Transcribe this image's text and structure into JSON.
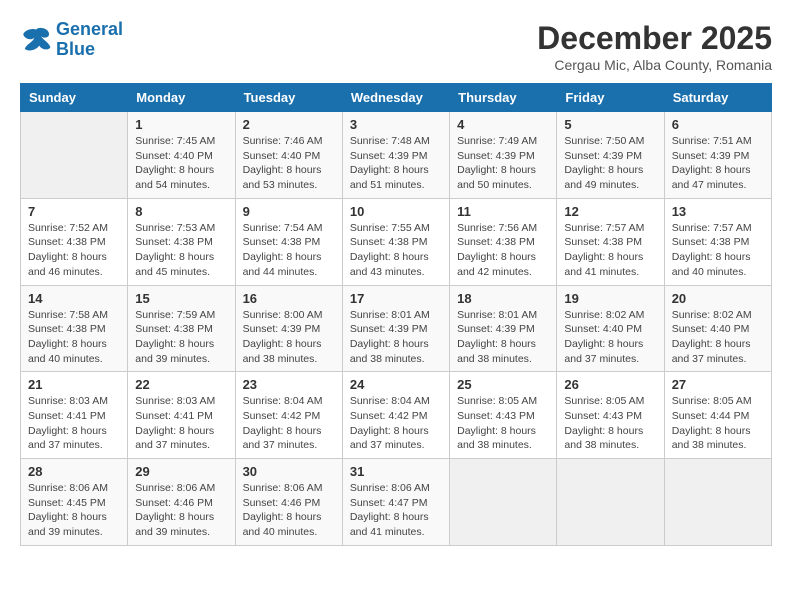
{
  "logo": {
    "line1": "General",
    "line2": "Blue"
  },
  "title": "December 2025",
  "subtitle": "Cergau Mic, Alba County, Romania",
  "days_of_week": [
    "Sunday",
    "Monday",
    "Tuesday",
    "Wednesday",
    "Thursday",
    "Friday",
    "Saturday"
  ],
  "weeks": [
    [
      {
        "day": "",
        "sunrise": "",
        "sunset": "",
        "daylight": ""
      },
      {
        "day": "1",
        "sunrise": "Sunrise: 7:45 AM",
        "sunset": "Sunset: 4:40 PM",
        "daylight": "Daylight: 8 hours and 54 minutes."
      },
      {
        "day": "2",
        "sunrise": "Sunrise: 7:46 AM",
        "sunset": "Sunset: 4:40 PM",
        "daylight": "Daylight: 8 hours and 53 minutes."
      },
      {
        "day": "3",
        "sunrise": "Sunrise: 7:48 AM",
        "sunset": "Sunset: 4:39 PM",
        "daylight": "Daylight: 8 hours and 51 minutes."
      },
      {
        "day": "4",
        "sunrise": "Sunrise: 7:49 AM",
        "sunset": "Sunset: 4:39 PM",
        "daylight": "Daylight: 8 hours and 50 minutes."
      },
      {
        "day": "5",
        "sunrise": "Sunrise: 7:50 AM",
        "sunset": "Sunset: 4:39 PM",
        "daylight": "Daylight: 8 hours and 49 minutes."
      },
      {
        "day": "6",
        "sunrise": "Sunrise: 7:51 AM",
        "sunset": "Sunset: 4:39 PM",
        "daylight": "Daylight: 8 hours and 47 minutes."
      }
    ],
    [
      {
        "day": "7",
        "sunrise": "Sunrise: 7:52 AM",
        "sunset": "Sunset: 4:38 PM",
        "daylight": "Daylight: 8 hours and 46 minutes."
      },
      {
        "day": "8",
        "sunrise": "Sunrise: 7:53 AM",
        "sunset": "Sunset: 4:38 PM",
        "daylight": "Daylight: 8 hours and 45 minutes."
      },
      {
        "day": "9",
        "sunrise": "Sunrise: 7:54 AM",
        "sunset": "Sunset: 4:38 PM",
        "daylight": "Daylight: 8 hours and 44 minutes."
      },
      {
        "day": "10",
        "sunrise": "Sunrise: 7:55 AM",
        "sunset": "Sunset: 4:38 PM",
        "daylight": "Daylight: 8 hours and 43 minutes."
      },
      {
        "day": "11",
        "sunrise": "Sunrise: 7:56 AM",
        "sunset": "Sunset: 4:38 PM",
        "daylight": "Daylight: 8 hours and 42 minutes."
      },
      {
        "day": "12",
        "sunrise": "Sunrise: 7:57 AM",
        "sunset": "Sunset: 4:38 PM",
        "daylight": "Daylight: 8 hours and 41 minutes."
      },
      {
        "day": "13",
        "sunrise": "Sunrise: 7:57 AM",
        "sunset": "Sunset: 4:38 PM",
        "daylight": "Daylight: 8 hours and 40 minutes."
      }
    ],
    [
      {
        "day": "14",
        "sunrise": "Sunrise: 7:58 AM",
        "sunset": "Sunset: 4:38 PM",
        "daylight": "Daylight: 8 hours and 40 minutes."
      },
      {
        "day": "15",
        "sunrise": "Sunrise: 7:59 AM",
        "sunset": "Sunset: 4:38 PM",
        "daylight": "Daylight: 8 hours and 39 minutes."
      },
      {
        "day": "16",
        "sunrise": "Sunrise: 8:00 AM",
        "sunset": "Sunset: 4:39 PM",
        "daylight": "Daylight: 8 hours and 38 minutes."
      },
      {
        "day": "17",
        "sunrise": "Sunrise: 8:01 AM",
        "sunset": "Sunset: 4:39 PM",
        "daylight": "Daylight: 8 hours and 38 minutes."
      },
      {
        "day": "18",
        "sunrise": "Sunrise: 8:01 AM",
        "sunset": "Sunset: 4:39 PM",
        "daylight": "Daylight: 8 hours and 38 minutes."
      },
      {
        "day": "19",
        "sunrise": "Sunrise: 8:02 AM",
        "sunset": "Sunset: 4:40 PM",
        "daylight": "Daylight: 8 hours and 37 minutes."
      },
      {
        "day": "20",
        "sunrise": "Sunrise: 8:02 AM",
        "sunset": "Sunset: 4:40 PM",
        "daylight": "Daylight: 8 hours and 37 minutes."
      }
    ],
    [
      {
        "day": "21",
        "sunrise": "Sunrise: 8:03 AM",
        "sunset": "Sunset: 4:41 PM",
        "daylight": "Daylight: 8 hours and 37 minutes."
      },
      {
        "day": "22",
        "sunrise": "Sunrise: 8:03 AM",
        "sunset": "Sunset: 4:41 PM",
        "daylight": "Daylight: 8 hours and 37 minutes."
      },
      {
        "day": "23",
        "sunrise": "Sunrise: 8:04 AM",
        "sunset": "Sunset: 4:42 PM",
        "daylight": "Daylight: 8 hours and 37 minutes."
      },
      {
        "day": "24",
        "sunrise": "Sunrise: 8:04 AM",
        "sunset": "Sunset: 4:42 PM",
        "daylight": "Daylight: 8 hours and 37 minutes."
      },
      {
        "day": "25",
        "sunrise": "Sunrise: 8:05 AM",
        "sunset": "Sunset: 4:43 PM",
        "daylight": "Daylight: 8 hours and 38 minutes."
      },
      {
        "day": "26",
        "sunrise": "Sunrise: 8:05 AM",
        "sunset": "Sunset: 4:43 PM",
        "daylight": "Daylight: 8 hours and 38 minutes."
      },
      {
        "day": "27",
        "sunrise": "Sunrise: 8:05 AM",
        "sunset": "Sunset: 4:44 PM",
        "daylight": "Daylight: 8 hours and 38 minutes."
      }
    ],
    [
      {
        "day": "28",
        "sunrise": "Sunrise: 8:06 AM",
        "sunset": "Sunset: 4:45 PM",
        "daylight": "Daylight: 8 hours and 39 minutes."
      },
      {
        "day": "29",
        "sunrise": "Sunrise: 8:06 AM",
        "sunset": "Sunset: 4:46 PM",
        "daylight": "Daylight: 8 hours and 39 minutes."
      },
      {
        "day": "30",
        "sunrise": "Sunrise: 8:06 AM",
        "sunset": "Sunset: 4:46 PM",
        "daylight": "Daylight: 8 hours and 40 minutes."
      },
      {
        "day": "31",
        "sunrise": "Sunrise: 8:06 AM",
        "sunset": "Sunset: 4:47 PM",
        "daylight": "Daylight: 8 hours and 41 minutes."
      },
      {
        "day": "",
        "sunrise": "",
        "sunset": "",
        "daylight": ""
      },
      {
        "day": "",
        "sunrise": "",
        "sunset": "",
        "daylight": ""
      },
      {
        "day": "",
        "sunrise": "",
        "sunset": "",
        "daylight": ""
      }
    ]
  ]
}
